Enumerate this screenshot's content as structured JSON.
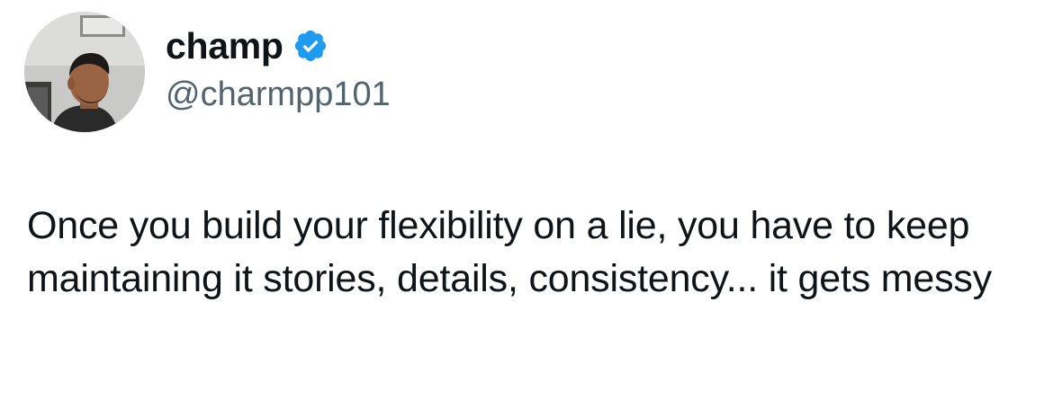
{
  "author": {
    "display_name": "champ",
    "handle": "@charmpp101",
    "verified": true,
    "verified_color": "#1d9bf0"
  },
  "tweet": {
    "text": "Once you build your flexibility on a lie, you have to keep maintaining it stories, details, consistency... it gets messy"
  },
  "icons": {
    "verified": "verified-badge-icon"
  },
  "colors": {
    "text_primary": "#0f1419",
    "text_secondary": "#536471",
    "background": "#ffffff"
  }
}
